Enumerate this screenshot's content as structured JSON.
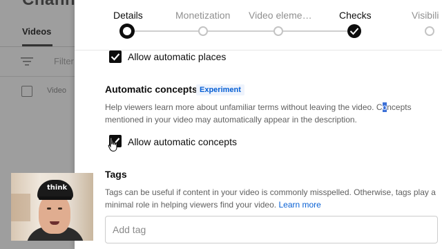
{
  "background": {
    "title": "Channel",
    "tab_videos": "Videos",
    "filter_placeholder": "Filter",
    "column_video": "Video"
  },
  "steps": [
    {
      "label": "Details",
      "state": "current"
    },
    {
      "label": "Monetization",
      "state": "pending"
    },
    {
      "label": "Video eleme…",
      "state": "pending"
    },
    {
      "label": "Checks",
      "state": "done"
    },
    {
      "label": "Visibili",
      "state": "pending"
    }
  ],
  "places": {
    "checkbox_label": "Allow automatic places",
    "checked": true
  },
  "concepts": {
    "title": "Automatic concepts",
    "badge": "Experiment",
    "help_part1": "Help viewers learn more about unfamiliar terms without leaving the video. C",
    "help_highlight": "o",
    "help_part2": "ncepts",
    "help_line2": "mentioned in your video may automatically appear in the description.",
    "checkbox_label": "Allow automatic concepts",
    "checked": true
  },
  "tags": {
    "title": "Tags",
    "help_line1": "Tags can be useful if content in your video is commonly misspelled. Otherwise, tags play a",
    "help_line2": "minimal role in helping viewers find your video.",
    "learn_more": "Learn more",
    "input_placeholder": "Add tag"
  },
  "webcam": {
    "cap_text": "think"
  },
  "colors": {
    "accent_link": "#065fd4",
    "checkbox": "#0d0d0d"
  }
}
